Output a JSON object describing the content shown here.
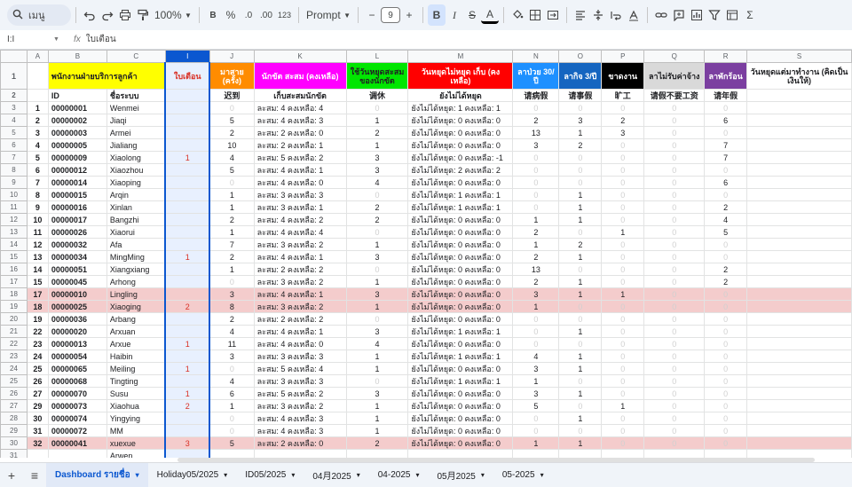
{
  "toolbar": {
    "search_label": "เมนู",
    "zoom": "100%",
    "bold": "B",
    "percent": "%",
    "dec_decrease": ".0",
    "dec_increase": ".00",
    "numfmt": "123",
    "font": "Prompt",
    "minus": "−",
    "font_size": "9",
    "plus": "+",
    "bold2": "B",
    "italic": "I",
    "strike": "S",
    "textcolor": "A",
    "sigma": "Σ"
  },
  "formula": {
    "namebox": "I:I",
    "fx": "fx",
    "value": "ใบเตือน"
  },
  "columns": [
    "A",
    "B",
    "C",
    "I",
    "J",
    "K",
    "L",
    "M",
    "N",
    "O",
    "P",
    "Q",
    "R",
    "S"
  ],
  "header1": {
    "B": "พนักงานฝ่ายบริการลูกค้า",
    "I": "ใบเตือน",
    "J": "มาสาย (ครั้ง)",
    "K": "นักขัต สะสม (คงเหลือ)",
    "L": "ใช้วันหยุดสะสม ของนักขัต",
    "M": "วันหยุดไม่หยุด เก็บ (คงเหลือ)",
    "N": "ลาป่วย 30/ปี",
    "O": "ลากิจ 3/ปี",
    "P": "ขาดงาน",
    "Q": "ลาไม่รับค่าจ้าง",
    "R": "ลาพักร้อน",
    "S": "วันหยุดแต่มาทำงาน (คิดเป็นเงินให้)"
  },
  "header2": {
    "B": "ID",
    "C": "ชื่อระบบ",
    "J": "迟到",
    "K": "เก็บสะสมนักขัต",
    "L": "调休",
    "M": "ยังไม่ได้หยุด",
    "N": "请病假",
    "O": "请事假",
    "P": "旷工",
    "Q": "请假不要工资",
    "R": "请年假"
  },
  "rows": [
    {
      "r": "3",
      "a": "1",
      "b": "00000001",
      "c": "Wenmei",
      "i": "",
      "j": "0",
      "k": "ละสม: 4 คงเหลือ: 4",
      "l": "0",
      "m": "ยังไม่ได้หยุด: 1 คงเหลือ: 1",
      "n": "0",
      "o": "0",
      "p": "0",
      "q": "0",
      "rr": "0",
      "hl": false
    },
    {
      "r": "4",
      "a": "2",
      "b": "00000002",
      "c": "Jiaqi",
      "i": "",
      "j": "5",
      "k": "ละสม: 4 คงเหลือ: 3",
      "l": "1",
      "m": "ยังไม่ได้หยุด: 0 คงเหลือ: 0",
      "n": "2",
      "o": "3",
      "p": "2",
      "q": "0",
      "rr": "6",
      "hl": false
    },
    {
      "r": "5",
      "a": "3",
      "b": "00000003",
      "c": "Armei",
      "i": "",
      "j": "2",
      "k": "ละสม: 2 คงเหลือ: 0",
      "l": "2",
      "m": "ยังไม่ได้หยุด: 0 คงเหลือ: 0",
      "n": "13",
      "o": "1",
      "p": "3",
      "q": "0",
      "rr": "0",
      "hl": false
    },
    {
      "r": "6",
      "a": "4",
      "b": "00000005",
      "c": "Jialiang",
      "i": "",
      "j": "10",
      "k": "ละสม: 2 คงเหลือ: 1",
      "l": "1",
      "m": "ยังไม่ได้หยุด: 0 คงเหลือ: 0",
      "n": "3",
      "o": "2",
      "p": "0",
      "q": "0",
      "rr": "7",
      "hl": false
    },
    {
      "r": "7",
      "a": "5",
      "b": "00000009",
      "c": "Xiaolong",
      "i": "1",
      "j": "4",
      "k": "ละสม: 5 คงเหลือ: 2",
      "l": "3",
      "m": "ยังไม่ได้หยุด: 0 คงเหลือ: -1",
      "n": "0",
      "o": "0",
      "p": "0",
      "q": "0",
      "rr": "7",
      "hl": false
    },
    {
      "r": "8",
      "a": "6",
      "b": "00000012",
      "c": "Xiaozhou",
      "i": "",
      "j": "5",
      "k": "ละสม: 4 คงเหลือ: 1",
      "l": "3",
      "m": "ยังไม่ได้หยุด: 2 คงเหลือ: 2",
      "n": "0",
      "o": "0",
      "p": "0",
      "q": "0",
      "rr": "0",
      "hl": false
    },
    {
      "r": "9",
      "a": "7",
      "b": "00000014",
      "c": "Xiaoping",
      "i": "",
      "j": "0",
      "k": "ละสม: 4 คงเหลือ: 0",
      "l": "4",
      "m": "ยังไม่ได้หยุด: 0 คงเหลือ: 0",
      "n": "0",
      "o": "0",
      "p": "0",
      "q": "0",
      "rr": "6",
      "hl": false
    },
    {
      "r": "10",
      "a": "8",
      "b": "00000015",
      "c": "Arqin",
      "i": "",
      "j": "1",
      "k": "ละสม: 3 คงเหลือ: 3",
      "l": "0",
      "m": "ยังไม่ได้หยุด: 1 คงเหลือ: 1",
      "n": "0",
      "o": "1",
      "p": "0",
      "q": "0",
      "rr": "0",
      "hl": false
    },
    {
      "r": "11",
      "a": "9",
      "b": "00000016",
      "c": "Xinlan",
      "i": "",
      "j": "1",
      "k": "ละสม: 3 คงเหลือ: 1",
      "l": "2",
      "m": "ยังไม่ได้หยุด: 1 คงเหลือ: 1",
      "n": "0",
      "o": "1",
      "p": "0",
      "q": "0",
      "rr": "2",
      "hl": false
    },
    {
      "r": "12",
      "a": "10",
      "b": "00000017",
      "c": "Bangzhi",
      "i": "",
      "j": "2",
      "k": "ละสม: 4 คงเหลือ: 2",
      "l": "2",
      "m": "ยังไม่ได้หยุด: 0 คงเหลือ: 0",
      "n": "1",
      "o": "1",
      "p": "0",
      "q": "0",
      "rr": "4",
      "hl": false
    },
    {
      "r": "13",
      "a": "11",
      "b": "00000026",
      "c": "Xiaorui",
      "i": "",
      "j": "1",
      "k": "ละสม: 4 คงเหลือ: 4",
      "l": "0",
      "m": "ยังไม่ได้หยุด: 0 คงเหลือ: 0",
      "n": "2",
      "o": "0",
      "p": "1",
      "q": "0",
      "rr": "5",
      "hl": false
    },
    {
      "r": "14",
      "a": "12",
      "b": "00000032",
      "c": "Afa",
      "i": "",
      "j": "7",
      "k": "ละสม: 3 คงเหลือ: 2",
      "l": "1",
      "m": "ยังไม่ได้หยุด: 0 คงเหลือ: 0",
      "n": "1",
      "o": "2",
      "p": "0",
      "q": "0",
      "rr": "0",
      "hl": false
    },
    {
      "r": "15",
      "a": "13",
      "b": "00000034",
      "c": "MingMing",
      "i": "1",
      "j": "2",
      "k": "ละสม: 4 คงเหลือ: 1",
      "l": "3",
      "m": "ยังไม่ได้หยุด: 0 คงเหลือ: 0",
      "n": "2",
      "o": "1",
      "p": "0",
      "q": "0",
      "rr": "0",
      "hl": false
    },
    {
      "r": "16",
      "a": "14",
      "b": "00000051",
      "c": "Xiangxiang",
      "i": "",
      "j": "1",
      "k": "ละสม: 2 คงเหลือ: 2",
      "l": "0",
      "m": "ยังไม่ได้หยุด: 0 คงเหลือ: 0",
      "n": "13",
      "o": "0",
      "p": "0",
      "q": "0",
      "rr": "2",
      "hl": false
    },
    {
      "r": "17",
      "a": "15",
      "b": "00000045",
      "c": "Arhong",
      "i": "",
      "j": "0",
      "k": "ละสม: 3 คงเหลือ: 2",
      "l": "1",
      "m": "ยังไม่ได้หยุด: 0 คงเหลือ: 0",
      "n": "2",
      "o": "1",
      "p": "0",
      "q": "0",
      "rr": "2",
      "hl": false
    },
    {
      "r": "18",
      "a": "17",
      "b": "00000010",
      "c": "Lingling",
      "i": "",
      "j": "3",
      "k": "ละสม: 4 คงเหลือ: 1",
      "l": "3",
      "m": "ยังไม่ได้หยุด: 0 คงเหลือ: 0",
      "n": "3",
      "o": "1",
      "p": "1",
      "q": "0",
      "rr": "0",
      "hl": true
    },
    {
      "r": "19",
      "a": "18",
      "b": "00000025",
      "c": "Xiaoging",
      "i": "2",
      "j": "8",
      "k": "ละสม: 3 คงเหลือ: 2",
      "l": "1",
      "m": "ยังไม่ได้หยุด: 0 คงเหลือ: 0",
      "n": "1",
      "o": "0",
      "p": "0",
      "q": "0",
      "rr": "0",
      "hl": true
    },
    {
      "r": "20",
      "a": "19",
      "b": "00000036",
      "c": "Arbang",
      "i": "",
      "j": "2",
      "k": "ละสม: 2 คงเหลือ: 2",
      "l": "0",
      "m": "ยังไม่ได้หยุด: 0 คงเหลือ: 0",
      "n": "0",
      "o": "0",
      "p": "0",
      "q": "0",
      "rr": "0",
      "hl": false
    },
    {
      "r": "21",
      "a": "22",
      "b": "00000020",
      "c": "Arxuan",
      "i": "",
      "j": "4",
      "k": "ละสม: 4 คงเหลือ: 1",
      "l": "3",
      "m": "ยังไม่ได้หยุด: 1 คงเหลือ: 1",
      "n": "0",
      "o": "1",
      "p": "0",
      "q": "0",
      "rr": "0",
      "hl": false
    },
    {
      "r": "22",
      "a": "23",
      "b": "00000013",
      "c": "Arxue",
      "i": "1",
      "j": "11",
      "k": "ละสม: 4 คงเหลือ: 0",
      "l": "4",
      "m": "ยังไม่ได้หยุด: 0 คงเหลือ: 0",
      "n": "0",
      "o": "0",
      "p": "0",
      "q": "0",
      "rr": "0",
      "hl": false
    },
    {
      "r": "23",
      "a": "24",
      "b": "00000054",
      "c": "Haibin",
      "i": "",
      "j": "3",
      "k": "ละสม: 3 คงเหลือ: 3",
      "l": "1",
      "m": "ยังไม่ได้หยุด: 1 คงเหลือ: 1",
      "n": "4",
      "o": "1",
      "p": "0",
      "q": "0",
      "rr": "0",
      "hl": false
    },
    {
      "r": "24",
      "a": "25",
      "b": "00000065",
      "c": "Meiling",
      "i": "1",
      "j": "0",
      "k": "ละสม: 5 คงเหลือ: 4",
      "l": "1",
      "m": "ยังไม่ได้หยุด: 0 คงเหลือ: 0",
      "n": "3",
      "o": "1",
      "p": "0",
      "q": "0",
      "rr": "0",
      "hl": false
    },
    {
      "r": "25",
      "a": "26",
      "b": "00000068",
      "c": "Tingting",
      "i": "",
      "j": "4",
      "k": "ละสม: 3 คงเหลือ: 3",
      "l": "0",
      "m": "ยังไม่ได้หยุด: 1 คงเหลือ: 1",
      "n": "1",
      "o": "0",
      "p": "0",
      "q": "0",
      "rr": "0",
      "hl": false
    },
    {
      "r": "26",
      "a": "27",
      "b": "00000070",
      "c": "Susu",
      "i": "1",
      "j": "6",
      "k": "ละสม: 5 คงเหลือ: 2",
      "l": "3",
      "m": "ยังไม่ได้หยุด: 0 คงเหลือ: 0",
      "n": "3",
      "o": "1",
      "p": "0",
      "q": "0",
      "rr": "0",
      "hl": false
    },
    {
      "r": "27",
      "a": "29",
      "b": "00000073",
      "c": "Xiaohua",
      "i": "2",
      "j": "1",
      "k": "ละสม: 3 คงเหลือ: 2",
      "l": "1",
      "m": "ยังไม่ได้หยุด: 0 คงเหลือ: 0",
      "n": "5",
      "o": "0",
      "p": "1",
      "q": "0",
      "rr": "0",
      "hl": false
    },
    {
      "r": "28",
      "a": "30",
      "b": "00000074",
      "c": "Yingying",
      "i": "",
      "j": "0",
      "k": "ละสม: 4 คงเหลือ: 3",
      "l": "1",
      "m": "ยังไม่ได้หยุด: 0 คงเหลือ: 0",
      "n": "0",
      "o": "1",
      "p": "0",
      "q": "0",
      "rr": "0",
      "hl": false
    },
    {
      "r": "29",
      "a": "31",
      "b": "00000072",
      "c": "MM",
      "i": "",
      "j": "0",
      "k": "ละสม: 4 คงเหลือ: 3",
      "l": "1",
      "m": "ยังไม่ได้หยุด: 0 คงเหลือ: 0",
      "n": "0",
      "o": "0",
      "p": "0",
      "q": "0",
      "rr": "0",
      "hl": false
    },
    {
      "r": "30",
      "a": "32",
      "b": "00000041",
      "c": "xuexue",
      "i": "3",
      "j": "5",
      "k": "ละสม: 2 คงเหลือ: 0",
      "l": "2",
      "m": "ยังไม่ได้หยุด: 0 คงเหลือ: 0",
      "n": "1",
      "o": "1",
      "p": "0",
      "q": "0",
      "rr": "0",
      "hl": true
    },
    {
      "r": "31",
      "a": "",
      "b": "",
      "c": "Arwen",
      "i": "",
      "j": "",
      "k": "",
      "l": "",
      "m": "",
      "n": "",
      "o": "",
      "p": "",
      "q": "",
      "rr": "",
      "hl": false
    },
    {
      "r": "32",
      "a": "",
      "b": "",
      "c": "Qiongqiong",
      "i": "",
      "j": "",
      "k": "",
      "l": "",
      "m": "",
      "n": "",
      "o": "",
      "p": "",
      "q": "",
      "rr": "",
      "hl": false
    }
  ],
  "header_colors": {
    "B": "#ffff00",
    "J": "#ff8c00",
    "K": "#ff00ff",
    "L": "#00e600",
    "M": "#ff0000",
    "N": "#1e90ff",
    "O": "#1565c0",
    "P": "#000000",
    "Q": "#d9d9d9",
    "R": "#7b3fa0",
    "S": "#ffffff"
  },
  "tabs": {
    "add_icon": "+",
    "menu_icon": "≡",
    "sheets": [
      "Dashboard รายชื่อ",
      "Holiday05/2025",
      "ID05/2025",
      "04月2025",
      "04-2025",
      "05月2025",
      "05-2025"
    ],
    "caret": "▾"
  }
}
